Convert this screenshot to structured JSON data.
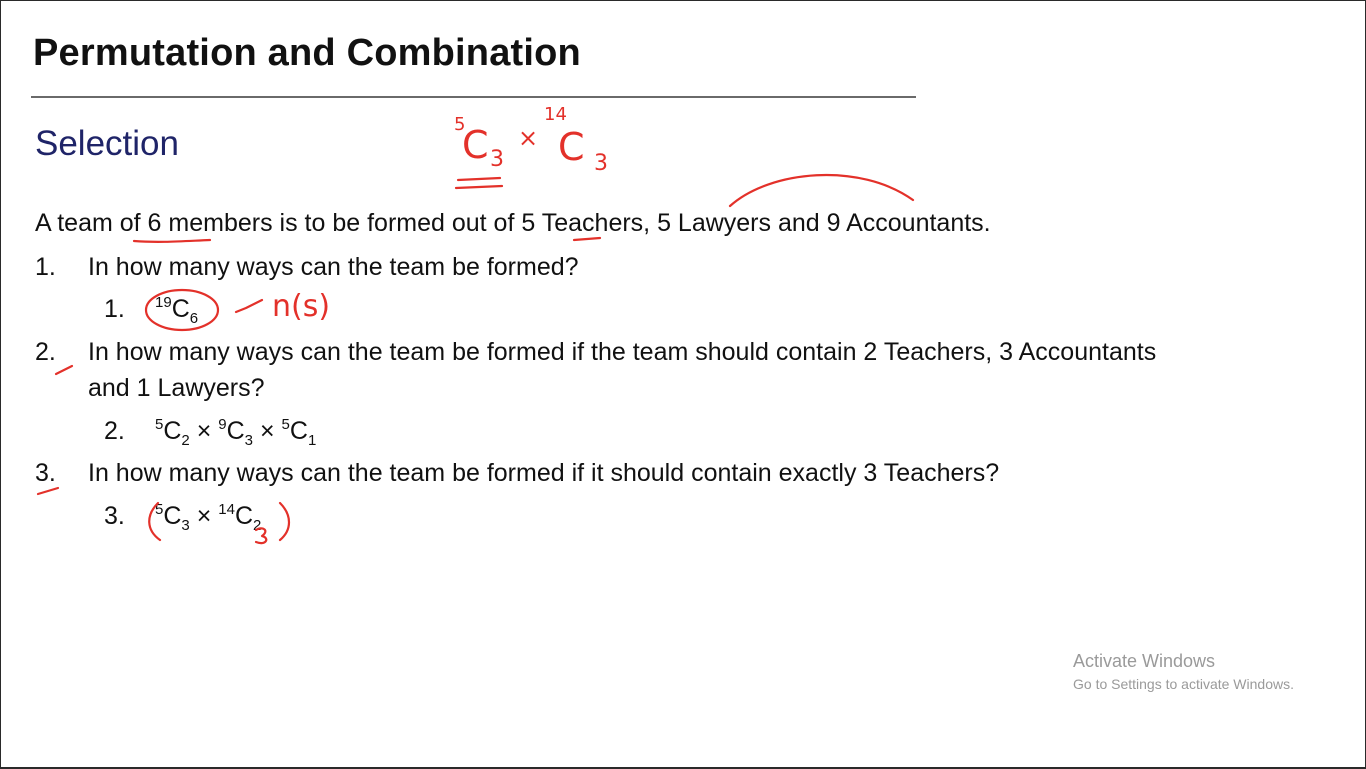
{
  "title": "Permutation and Combination",
  "subtitle": "Selection",
  "intro": "A team of 6 members is to be formed out of 5 Teachers, 5 Lawyers and 9 Accountants.",
  "questions": [
    {
      "num": "1.",
      "text": "In how many ways can the team be formed?"
    },
    {
      "num": "2.",
      "text_line1": "In how many ways can the team be formed if the team should contain 2 Teachers, 3 Accountants",
      "text_line2": "and 1 Lawyers?"
    },
    {
      "num": "3.",
      "text": "In how many ways can the team be formed if it should contain exactly 3 Teachers?"
    }
  ],
  "answers": [
    {
      "num": "1.",
      "sup1": "19",
      "c1": "C",
      "sub1": "6"
    },
    {
      "num": "2.",
      "sup1": "5",
      "c1": "C",
      "sub1": "2",
      "op1": "×",
      "sup2": "9",
      "c2": "C",
      "sub2": "3",
      "op2": "×",
      "sup3": "5",
      "c3": "C",
      "sub3": "1"
    },
    {
      "num": "3.",
      "sup1": "5",
      "c1": "C",
      "sub1": "3",
      "op1": "×",
      "sup2": "14",
      "c2": "C",
      "sub2": "2"
    }
  ],
  "annotations": {
    "top_sup1": "5",
    "top_c1": "C",
    "top_sub1": "3",
    "top_times": "×",
    "top_sup2": "14",
    "top_c2": "C",
    "top_sub2": "3",
    "ns_label": "n(s)"
  },
  "watermark": {
    "line1": "Activate Windows",
    "line2": "Go to Settings to activate Windows."
  },
  "colors": {
    "ink": "#e3312a",
    "subtitle": "#1f2468",
    "watermark": "#9a9a9a"
  }
}
